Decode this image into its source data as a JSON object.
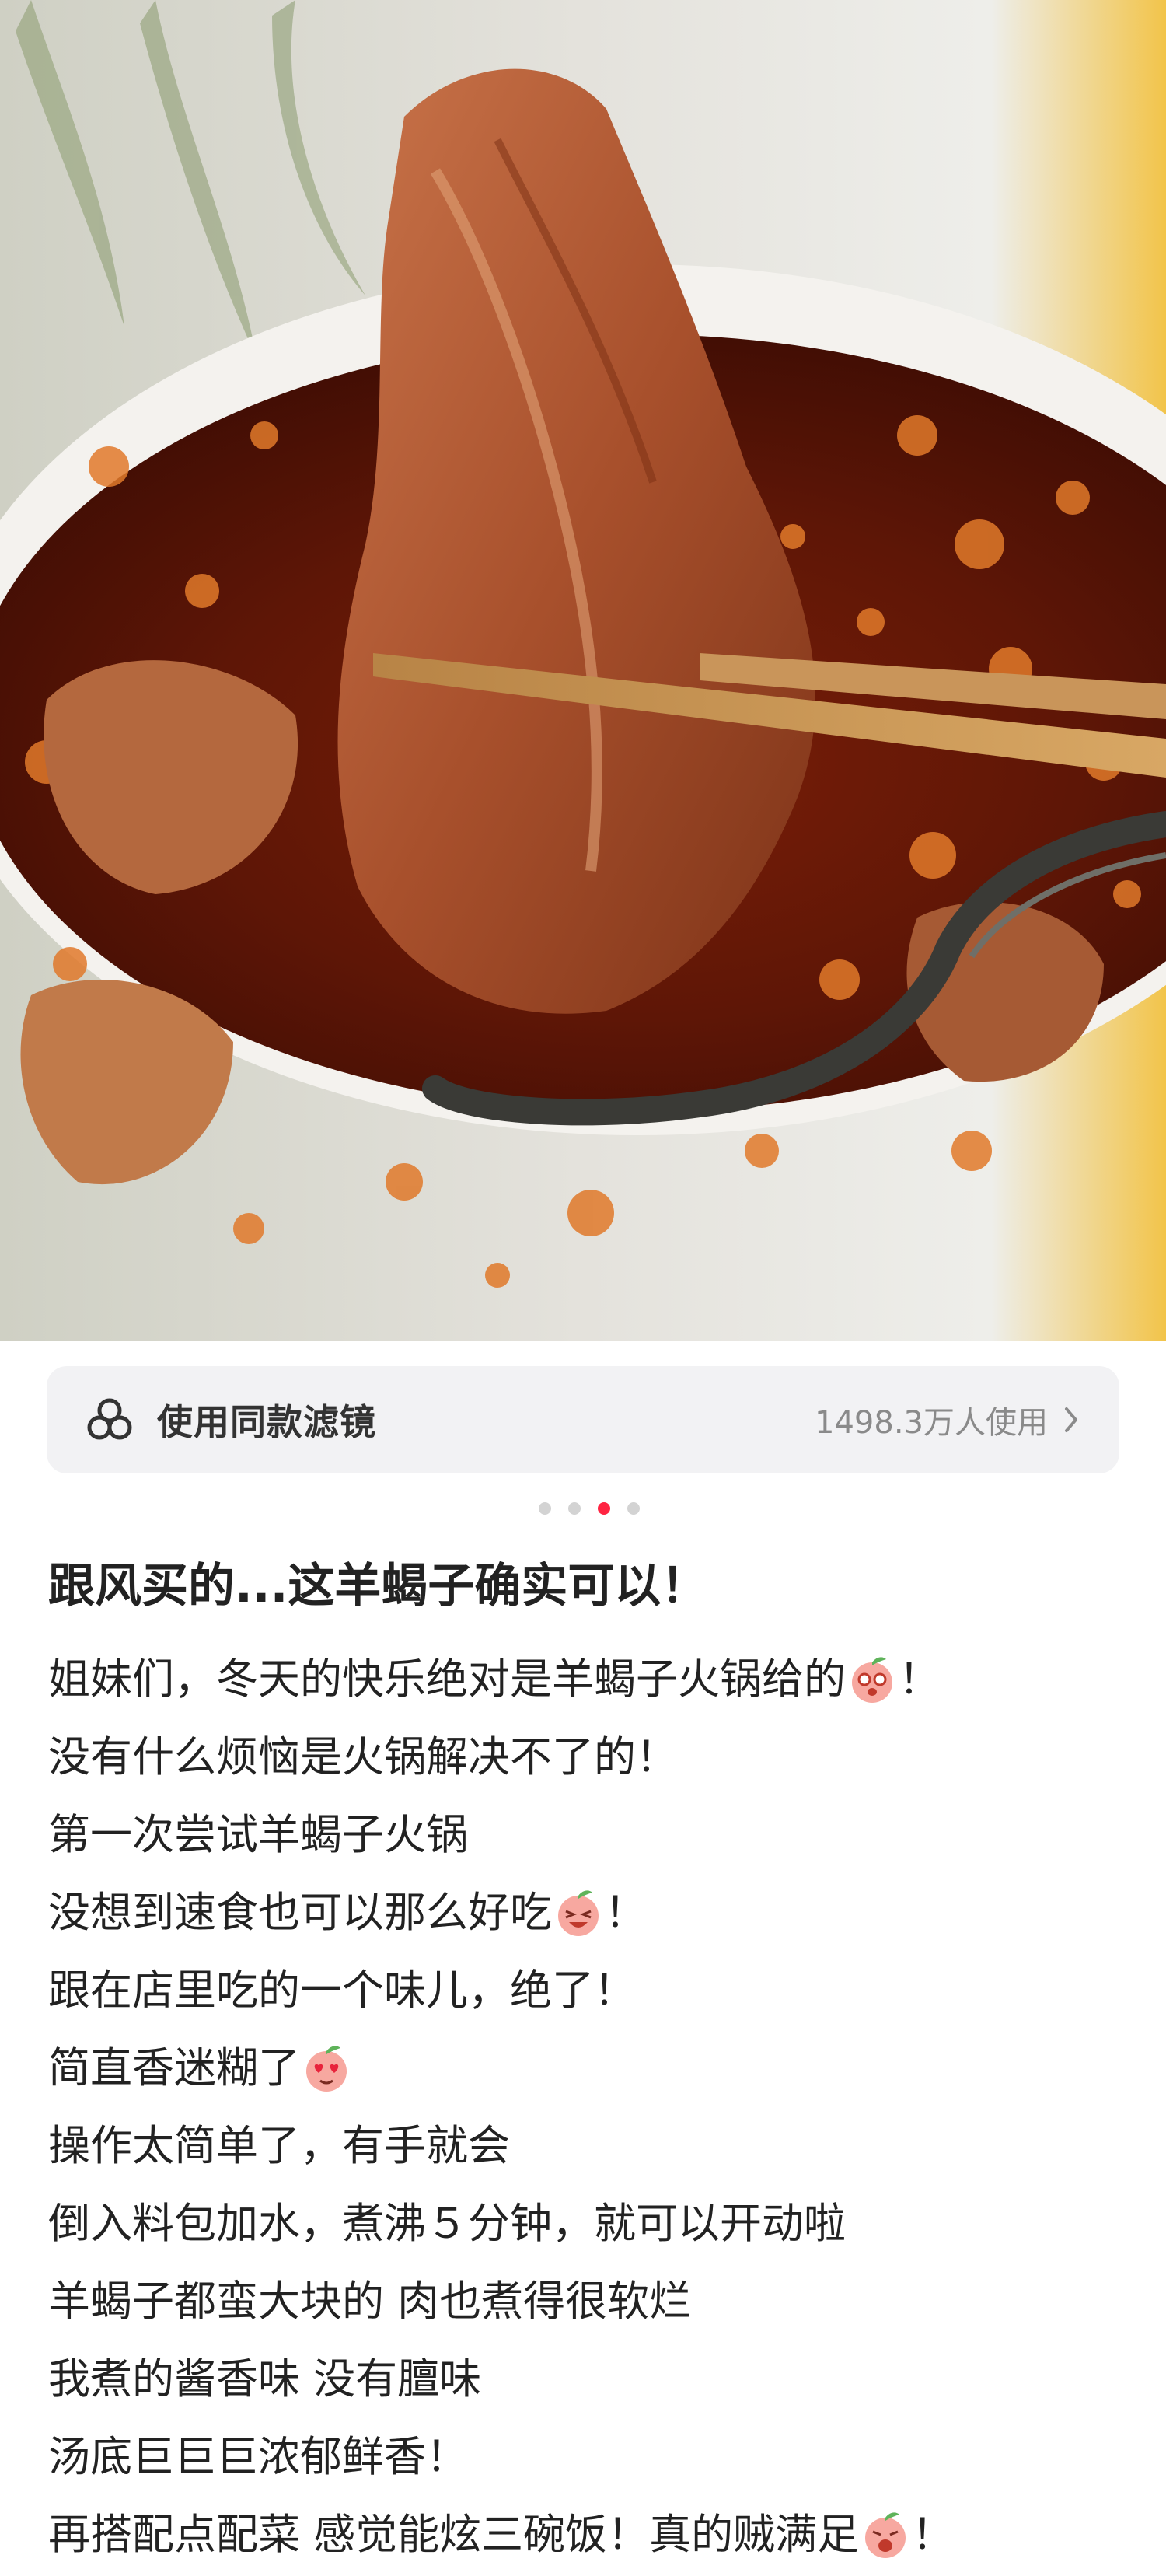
{
  "filter": {
    "label": "使用同款滤镜",
    "usage": "1498.3万人使用",
    "icon": "filter-circles-icon"
  },
  "carousel": {
    "total": 4,
    "active_index": 2
  },
  "colors": {
    "accent": "#ff2442",
    "dot_inactive": "#d3d3d3",
    "filter_bg": "#f2f2f4"
  },
  "post": {
    "title": "跟风买的...这羊蝎子确实可以！",
    "lines": [
      {
        "text": "姐妹们，冬天的快乐绝对是羊蝎子火锅给的",
        "emoji": "peach-drooling-emoji",
        "after": "！"
      },
      {
        "text": "没有什么烦恼是火锅解决不了的！",
        "emoji": "",
        "after": ""
      },
      {
        "text": "第一次尝试羊蝎子火锅",
        "emoji": "",
        "after": ""
      },
      {
        "text": "没想到速食也可以那么好吃",
        "emoji": "peach-grin-emoji",
        "after": "！"
      },
      {
        "text": "跟在店里吃的一个味儿，绝了！",
        "emoji": "",
        "after": ""
      },
      {
        "text": "简直香迷糊了",
        "emoji": "peach-heart-eyes-emoji",
        "after": ""
      },
      {
        "text": "操作太简单了，有手就会",
        "emoji": "",
        "after": ""
      },
      {
        "text": "倒入料包加水，煮沸５分钟，就可以开动啦",
        "emoji": "",
        "after": ""
      },
      {
        "text": "羊蝎子都蛮大块的 肉也煮得很软烂",
        "emoji": "",
        "after": ""
      },
      {
        "text": "我煮的酱香味 没有膻味",
        "emoji": "",
        "after": ""
      },
      {
        "text": "汤底巨巨巨浓郁鲜香！",
        "emoji": "",
        "after": ""
      },
      {
        "text": "再搭配点配菜 感觉能炫三碗饭！真的贼满足",
        "emoji": "peach-excited-emoji",
        "after": "！"
      }
    ]
  }
}
